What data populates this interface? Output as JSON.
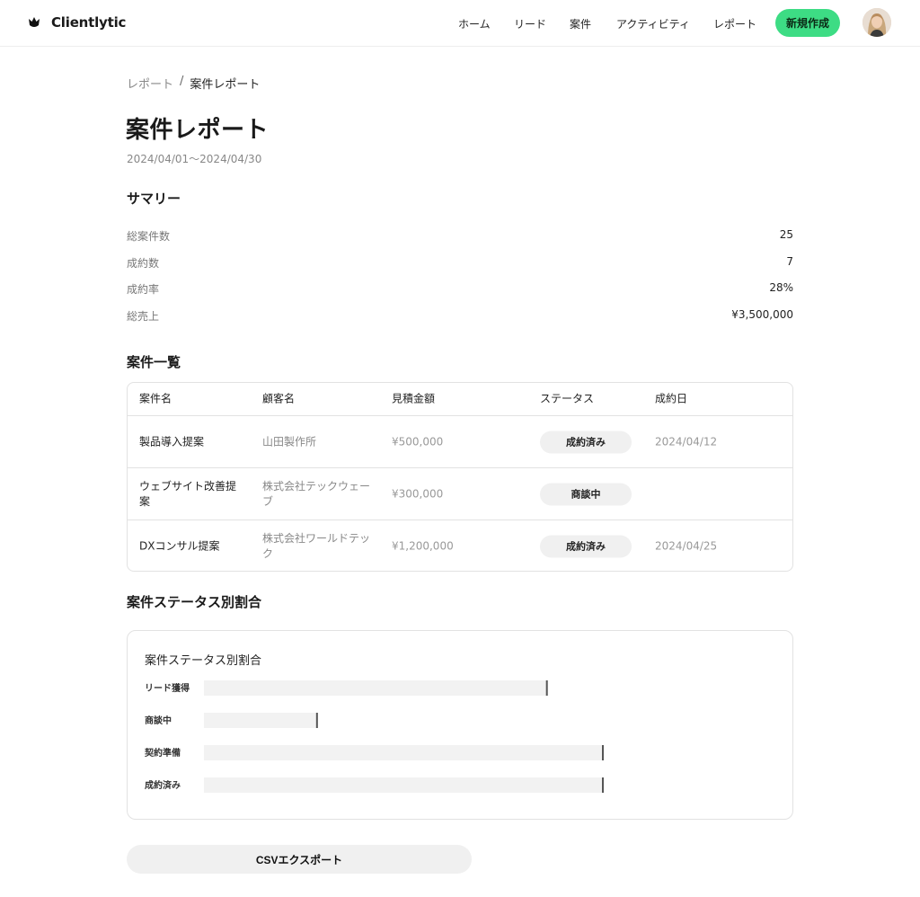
{
  "app": {
    "brand": "Clientlytic"
  },
  "nav": {
    "items": [
      {
        "label": "ホーム"
      },
      {
        "label": "リード"
      },
      {
        "label": "案件"
      },
      {
        "label": "アクティビティ"
      },
      {
        "label": "レポート"
      }
    ],
    "new_button": "新規作成"
  },
  "breadcrumb": {
    "parent": "レポート",
    "separator": "/",
    "current": "案件レポート"
  },
  "page": {
    "title": "案件レポート",
    "date_range": "2024/04/01〜2024/04/30"
  },
  "summary": {
    "title": "サマリー",
    "rows": [
      {
        "label": "総案件数",
        "value": "25"
      },
      {
        "label": "成約数",
        "value": "7"
      },
      {
        "label": "成約率",
        "value": "28%"
      },
      {
        "label": "総売上",
        "value": "¥3,500,000"
      }
    ]
  },
  "deals": {
    "title": "案件一覧",
    "columns": [
      "案件名",
      "顧客名",
      "見積金額",
      "ステータス",
      "成約日"
    ],
    "rows": [
      {
        "name": "製品導入提案",
        "customer": "山田製作所",
        "amount": "¥500,000",
        "status": "成約済み",
        "closed": "2024/04/12"
      },
      {
        "name": "ウェブサイト改善提案",
        "customer": "株式会社テックウェーブ",
        "amount": "¥300,000",
        "status": "商談中",
        "closed": ""
      },
      {
        "name": "DXコンサル提案",
        "customer": "株式会社ワールドテック",
        "amount": "¥1,200,000",
        "status": "成約済み",
        "closed": "2024/04/25"
      }
    ]
  },
  "status_section": {
    "title": "案件ステータス別割合"
  },
  "chart_data": {
    "type": "bar",
    "orientation": "horizontal",
    "title": "案件ステータス別割合",
    "categories": [
      "リード獲得",
      "商談中",
      "契約準備",
      "成約済み"
    ],
    "values": [
      86,
      28.5,
      100,
      100
    ],
    "xlim": [
      0,
      100
    ],
    "grid": false,
    "colors": {
      "bar": "#f2f2f2",
      "end_marker": "#555555"
    }
  },
  "actions": {
    "csv_export": "CSVエクスポート"
  }
}
